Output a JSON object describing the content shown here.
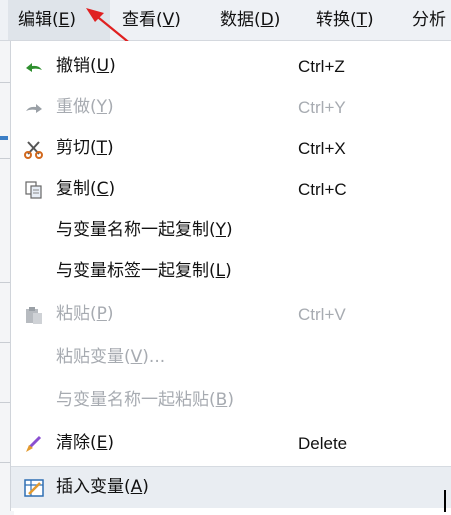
{
  "menubar": {
    "items": [
      {
        "label": "编辑",
        "mnemonic_open": "(",
        "mnemonic": "E",
        "mnemonic_close": ")"
      },
      {
        "label": "查看",
        "mnemonic_open": "(",
        "mnemonic": "V",
        "mnemonic_close": ")"
      },
      {
        "label": "数据",
        "mnemonic_open": "(",
        "mnemonic": "D",
        "mnemonic_close": ")"
      },
      {
        "label": "转换",
        "mnemonic_open": "(",
        "mnemonic": "T",
        "mnemonic_close": ")"
      },
      {
        "label": "分析",
        "mnemonic_open": "",
        "mnemonic": "",
        "mnemonic_close": ""
      }
    ]
  },
  "menu": {
    "items": [
      {
        "label": "撤销",
        "mn": "U",
        "shortcut": "Ctrl+Z",
        "icon": "undo-icon",
        "disabled": false
      },
      {
        "label": "重做",
        "mn": "Y",
        "shortcut": "Ctrl+Y",
        "icon": "redo-icon",
        "disabled": true
      },
      {
        "label": "剪切",
        "mn": "T",
        "shortcut": "Ctrl+X",
        "icon": "scissors-icon",
        "disabled": false
      },
      {
        "label": "复制",
        "mn": "C",
        "shortcut": "Ctrl+C",
        "icon": "copy-icon",
        "disabled": false
      },
      {
        "label": "与变量名称一起复制",
        "mn": "Y",
        "shortcut": "",
        "icon": "",
        "disabled": false
      },
      {
        "label": "与变量标签一起复制",
        "mn": "L",
        "shortcut": "",
        "icon": "",
        "disabled": false
      },
      {
        "label": "粘贴",
        "mn": "P",
        "shortcut": "Ctrl+V",
        "icon": "paste-icon",
        "disabled": true
      },
      {
        "label": "粘贴变量",
        "mn": "V",
        "suffix": "...",
        "shortcut": "",
        "icon": "",
        "disabled": true
      },
      {
        "label": "与变量名称一起粘贴",
        "mn": "B",
        "shortcut": "",
        "icon": "",
        "disabled": true
      },
      {
        "label": "清除",
        "mn": "E",
        "shortcut": "Delete",
        "icon": "eraser-icon",
        "disabled": false
      },
      {
        "label": "插入变量",
        "mn": "A",
        "shortcut": "",
        "icon": "insert-variable-icon",
        "disabled": false
      }
    ]
  },
  "colors": {
    "annotation": "#e02020",
    "disabled_text": "#a7abb1",
    "undo_green": "#2f8f2f"
  }
}
